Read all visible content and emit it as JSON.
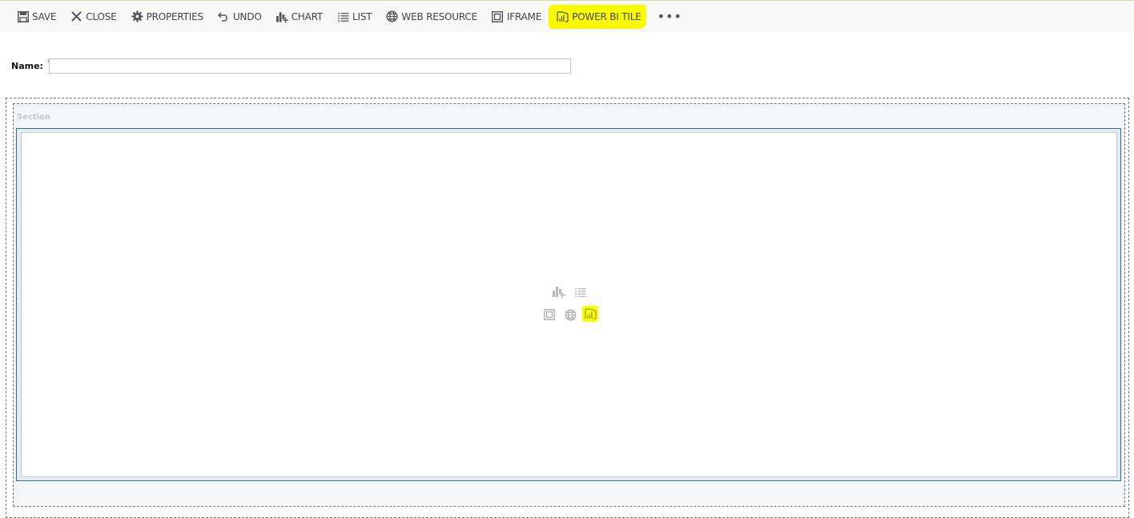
{
  "toolbar": {
    "buttons": [
      {
        "id": "save",
        "label": "SAVE",
        "icon": "save-icon"
      },
      {
        "id": "close",
        "label": "CLOSE",
        "icon": "close-icon"
      },
      {
        "id": "properties",
        "label": "PROPERTIES",
        "icon": "gear-icon"
      },
      {
        "id": "undo",
        "label": "UNDO",
        "icon": "undo-icon"
      },
      {
        "id": "chart",
        "label": "CHART",
        "icon": "chart-add-icon"
      },
      {
        "id": "list",
        "label": "LIST",
        "icon": "list-icon"
      },
      {
        "id": "web_resource",
        "label": "WEB RESOURCE",
        "icon": "globe-icon"
      },
      {
        "id": "iframe",
        "label": "IFRAME",
        "icon": "iframe-icon"
      },
      {
        "id": "power_bi_tile",
        "label": "POWER BI TILE",
        "icon": "power-bi-icon",
        "highlighted": true
      }
    ],
    "more_label": "•••",
    "highlight_color": "#fbfb00"
  },
  "form": {
    "name_label": "Name:",
    "required_marker": "*",
    "name_value": "",
    "name_placeholder": ""
  },
  "section": {
    "label": "Section",
    "placeholder_icons": [
      "chart-add-icon",
      "list-icon",
      "iframe-icon",
      "globe-icon",
      "power-bi-icon"
    ]
  },
  "colors": {
    "accent_border": "#1a73a0",
    "required": "#cc0000",
    "highlight": "#fbfb00"
  }
}
